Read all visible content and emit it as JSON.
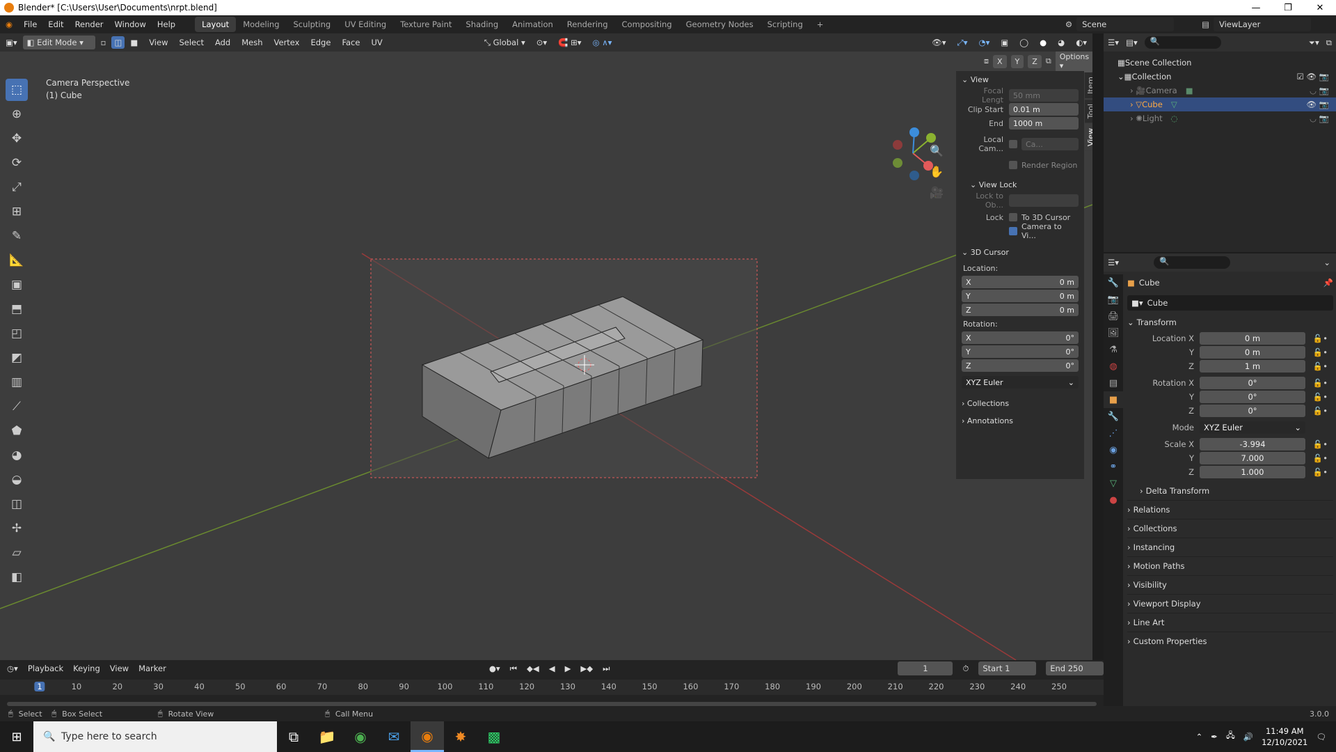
{
  "window": {
    "title": "Blender* [C:\\Users\\User\\Documents\\nrpt.blend]",
    "minimize": "—",
    "maximize": "❐",
    "close": "✕"
  },
  "menu": {
    "items": [
      "File",
      "Edit",
      "Render",
      "Window",
      "Help"
    ],
    "workspaces": [
      "Layout",
      "Modeling",
      "Sculpting",
      "UV Editing",
      "Texture Paint",
      "Shading",
      "Animation",
      "Rendering",
      "Compositing",
      "Geometry Nodes",
      "Scripting"
    ],
    "add_workspace": "+",
    "scene": "Scene",
    "view_layer": "ViewLayer"
  },
  "header3d": {
    "mode": "Edit Mode",
    "menus": [
      "View",
      "Select",
      "Add",
      "Mesh",
      "Vertex",
      "Edge",
      "Face",
      "UV"
    ],
    "orientation": "Global",
    "axes": [
      "X",
      "Y",
      "Z"
    ],
    "options": "Options"
  },
  "viewport": {
    "perspective": "Camera Perspective",
    "object": "(1) Cube"
  },
  "npanel": {
    "tabs": [
      "Item",
      "Tool",
      "View"
    ],
    "view": {
      "title": "View",
      "focal_label": "Focal Lengt",
      "focal_value": "50 mm",
      "clip_start_label": "Clip Start",
      "clip_start_value": "0.01 m",
      "end_label": "End",
      "end_value": "1000 m",
      "local_cam_label": "Local Cam...",
      "local_cam_value": "Ca...",
      "render_region": "Render Region"
    },
    "view_lock": {
      "title": "View Lock",
      "lock_to_label": "Lock to Ob...",
      "lock_label": "Lock",
      "to_cursor": "To 3D Cursor",
      "camera_to_view": "Camera to Vi..."
    },
    "cursor": {
      "title": "3D Cursor",
      "location_label": "Location:",
      "loc": [
        {
          "axis": "X",
          "value": "0 m"
        },
        {
          "axis": "Y",
          "value": "0 m"
        },
        {
          "axis": "Z",
          "value": "0 m"
        }
      ],
      "rotation_label": "Rotation:",
      "rot": [
        {
          "axis": "X",
          "value": "0°"
        },
        {
          "axis": "Y",
          "value": "0°"
        },
        {
          "axis": "Z",
          "value": "0°"
        }
      ],
      "mode": "XYZ Euler"
    },
    "collections": "Collections",
    "annotations": "Annotations"
  },
  "outliner": {
    "root": "Scene Collection",
    "collection": "Collection",
    "items": [
      "Camera",
      "Cube",
      "Light"
    ]
  },
  "properties": {
    "object_name": "Cube",
    "data_name": "Cube",
    "transform_title": "Transform",
    "location": [
      {
        "label": "Location X",
        "value": "0 m"
      },
      {
        "label": "Y",
        "value": "0 m"
      },
      {
        "label": "Z",
        "value": "1 m"
      }
    ],
    "rotation": [
      {
        "label": "Rotation X",
        "value": "0°"
      },
      {
        "label": "Y",
        "value": "0°"
      },
      {
        "label": "Z",
        "value": "0°"
      }
    ],
    "mode_label": "Mode",
    "mode_value": "XYZ Euler",
    "scale": [
      {
        "label": "Scale X",
        "value": "-3.994"
      },
      {
        "label": "Y",
        "value": "7.000"
      },
      {
        "label": "Z",
        "value": "1.000"
      }
    ],
    "delta": "Delta Transform",
    "sections": [
      "Relations",
      "Collections",
      "Instancing",
      "Motion Paths",
      "Visibility",
      "Viewport Display",
      "Line Art",
      "Custom Properties"
    ]
  },
  "timeline": {
    "menus": [
      "Playback",
      "Keying",
      "View",
      "Marker"
    ],
    "current": "1",
    "start_label": "Start",
    "start": "1",
    "end_label": "End",
    "end": "250",
    "ticks": [
      "1",
      "10",
      "20",
      "30",
      "40",
      "50",
      "60",
      "70",
      "80",
      "90",
      "100",
      "110",
      "120",
      "130",
      "140",
      "150",
      "160",
      "170",
      "180",
      "190",
      "200",
      "210",
      "220",
      "230",
      "240",
      "250"
    ]
  },
  "status": {
    "select": "Select",
    "box_select": "Box Select",
    "rotate": "Rotate View",
    "call_menu": "Call Menu",
    "version": "3.0.0"
  },
  "taskbar": {
    "search": "Type here to search",
    "time": "11:49 AM",
    "date": "12/10/2021"
  }
}
